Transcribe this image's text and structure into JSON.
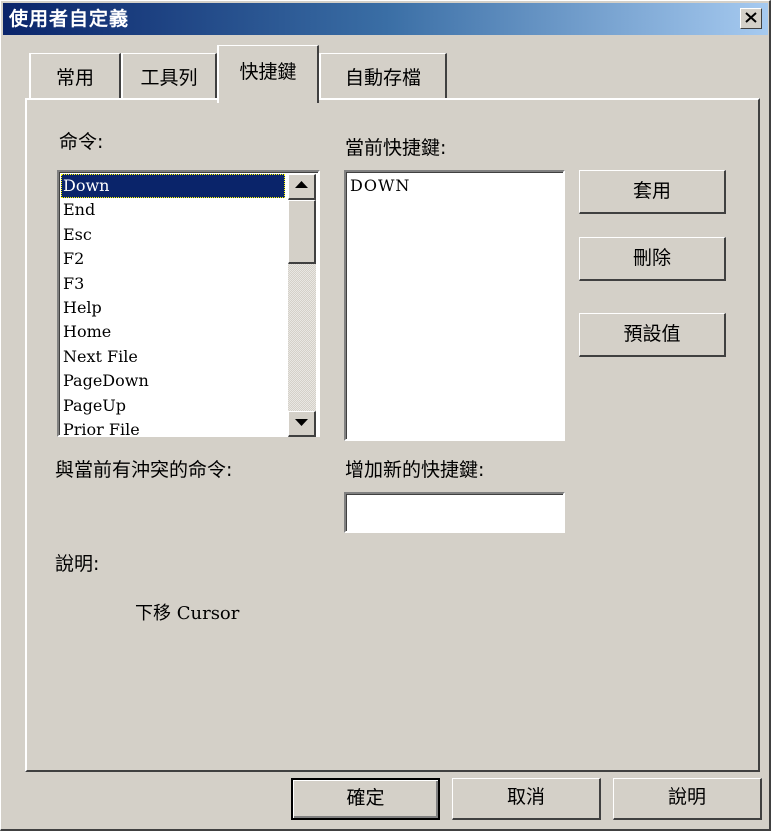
{
  "window": {
    "title": "使用者自定義"
  },
  "tabs": [
    {
      "label": "常用",
      "active": false
    },
    {
      "label": "工具列",
      "active": false
    },
    {
      "label": "快捷鍵",
      "active": true
    },
    {
      "label": "自動存檔",
      "active": false
    }
  ],
  "commands": {
    "label": "命令:",
    "items": [
      "Down",
      "End",
      "Esc",
      "F2",
      "F3",
      "Help",
      "Home",
      "Next File",
      "PageDown",
      "PageUp",
      "Prior File"
    ],
    "selected": "Down"
  },
  "current_shortcuts": {
    "label": "當前快捷鍵:",
    "items": [
      "DOWN"
    ]
  },
  "conflicts": {
    "label": "與當前有沖突的命令:"
  },
  "new_shortcut": {
    "label": "增加新的快捷鍵:",
    "value": ""
  },
  "description": {
    "label": "說明:",
    "text": "下移 Cursor"
  },
  "side_buttons": {
    "apply": "套用",
    "delete": "刪除",
    "defaults": "預設值"
  },
  "footer_buttons": {
    "ok": "確定",
    "cancel": "取消",
    "help": "說明"
  },
  "colors": {
    "dialog_bg": "#d4d0c8",
    "title_gradient_start": "#0a246a",
    "title_gradient_end": "#a6caf0",
    "selection": "#0a246a"
  }
}
